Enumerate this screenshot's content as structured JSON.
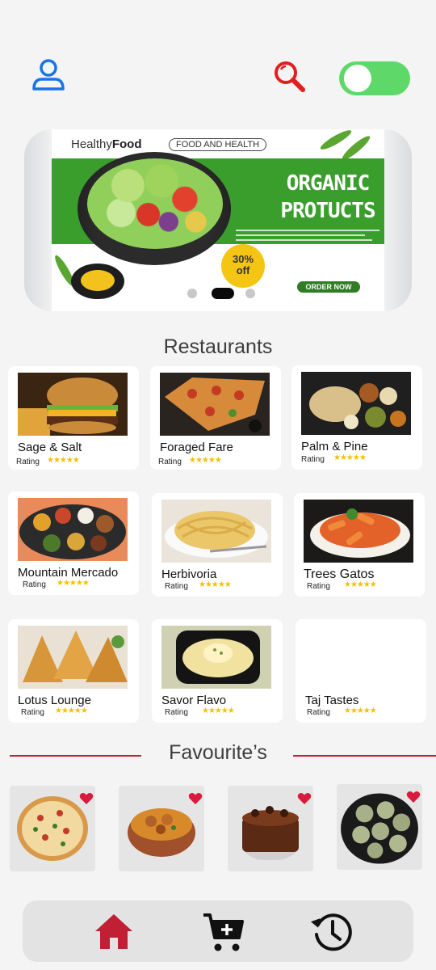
{
  "header": {
    "icons": [
      "user-icon",
      "search-icon",
      "theme-toggle"
    ]
  },
  "banner": {
    "brand_light": "Healthy",
    "brand_bold": "Food",
    "tag": "FOOD AND HEALTH",
    "title_line1": "ORGANIC",
    "title_line2": "PROTUCTS",
    "discount_line1": "30%",
    "discount_line2": "off",
    "cta": "ORDER NOW",
    "slides": 3,
    "active_slide": 2
  },
  "sections": {
    "restaurants_title": "Restaurants",
    "favourites_title": "Favourite’s"
  },
  "restaurants": [
    {
      "name": "Sage & Salt",
      "rating_label": "Rating",
      "stars": "★★★★★"
    },
    {
      "name": "Foraged Fare",
      "rating_label": "Rating",
      "stars": "★★★★★"
    },
    {
      "name": "Palm & Pine",
      "rating_label": "Rating",
      "stars": "★★★★★"
    },
    {
      "name": "Mountain Mercado",
      "rating_label": "Rating",
      "stars": "★★★★★"
    },
    {
      "name": "Herbivoria",
      "rating_label": "Rating",
      "stars": "★★★★★"
    },
    {
      "name": "Trees Gatos",
      "rating_label": "Rating",
      "stars": "★★★★★"
    },
    {
      "name": "Lotus Lounge",
      "rating_label": "Rating",
      "stars": "★★★★★"
    },
    {
      "name": "Savor Flavo",
      "rating_label": "Rating",
      "stars": "★★★★★"
    },
    {
      "name": "Taj Tastes",
      "rating_label": "Rating",
      "stars": "★★★★★"
    }
  ],
  "favourites": [
    "pizza-image",
    "curry-image",
    "cake-image",
    "momos-image"
  ],
  "nav": {
    "items": [
      "home-icon",
      "cart-add-icon",
      "history-icon"
    ]
  },
  "colors": {
    "accent_red": "#c41e3a",
    "toggle_green": "#5fd86a",
    "banner_green": "#3a9e2c",
    "star_yellow": "#f5c000",
    "profile_blue": "#1a73e8"
  }
}
